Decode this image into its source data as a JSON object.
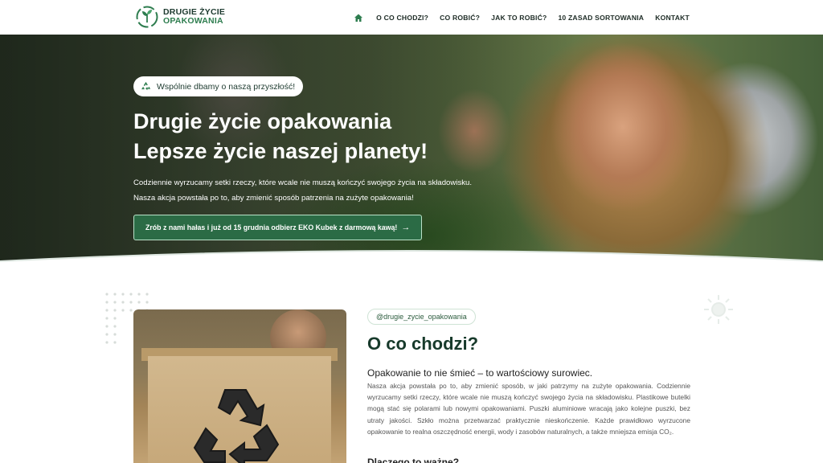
{
  "brand": {
    "line1": "DRUGIE ŻYCIE",
    "line2": "OPAKOWANIA",
    "primary": "#2e7d4f",
    "dark": "#173a2b"
  },
  "nav": {
    "home_icon": "house-icon",
    "items": [
      "O CO CHODZI?",
      "CO ROBIĆ?",
      "JAK TO ROBIĆ?",
      "10 ZASAD SORTOWANIA",
      "KONTAKT"
    ]
  },
  "hero": {
    "badge": "Wspólnie dbamy o naszą przyszłość!",
    "title_line1": "Drugie życie opakowania",
    "title_line2": "Lepsze życie naszej planety!",
    "text_line1": "Codziennie wyrzucamy setki rzeczy, które wcale nie muszą kończyć swojego życia na składowisku.",
    "text_line2": "Nasza akcja powstała po to, aby zmienić sposób patrzenia na zużyte opakowania!",
    "cta": "Zrób z nami hałas i już od 15 grudnia odbierz EKO Kubek z darmową kawą!",
    "cta_arrow": "→"
  },
  "section": {
    "tag": "@drugie_zycie_opakowania",
    "title": "O co chodzi?",
    "subtitle": "Opakowanie to nie śmieć – to wartościowy surowiec.",
    "body": "Nasza akcja powstała po to, aby zmienić sposób, w jaki patrzymy na zużyte opakowania. Codziennie wyrzucamy setki rzeczy, które wcale nie muszą kończyć swojego życia na składowisku. Plastikowe butelki mogą stać się polarami lub nowymi opakowaniami. Puszki aluminiowe wracają jako kolejne puszki, bez utraty jakości. Szkło można przetwarzać praktycznie nieskończenie. Każde prawidłowo wyrzucone opakowanie to realna oszczędność energii, wody i zasobów naturalnych, a także mniejsza emisja CO₂.",
    "next_heading": "Dlaczego to ważne?"
  }
}
